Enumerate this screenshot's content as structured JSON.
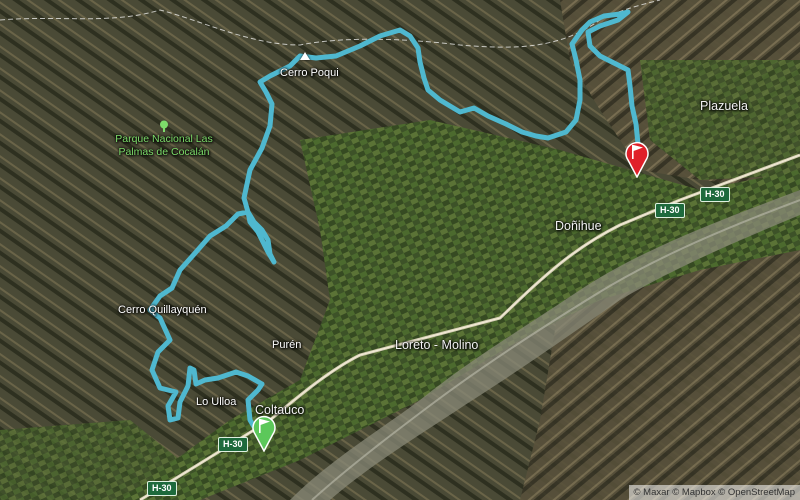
{
  "map": {
    "places": {
      "cerro_poqui": "Cerro Poqui",
      "parque": "Parque Nacional Las Palmas de Cocalán",
      "plazuela": "Plazuela",
      "donihue": "Doñihue",
      "cerro_quillayquen": "Cerro Quillayquén",
      "puren": "Purén",
      "loreto_molino": "Loreto - Molino",
      "lo_ulloa": "Lo Ulloa",
      "coltauco": "Coltauco"
    },
    "roads": [
      "H-30",
      "H-30",
      "H-30",
      "H-30"
    ],
    "attribution": "© Maxar © Mapbox © OpenStreetMap",
    "colors": {
      "route": "#4fb8cf",
      "start_flag": "#5cc85a",
      "end_flag": "#e0202a",
      "road_shield": "#1e6a3c",
      "park_label": "#7ddc6a"
    },
    "icons": {
      "start": "start-flag-icon",
      "end": "end-flag-icon",
      "summit": "summit-icon",
      "park": "tree-icon"
    }
  }
}
